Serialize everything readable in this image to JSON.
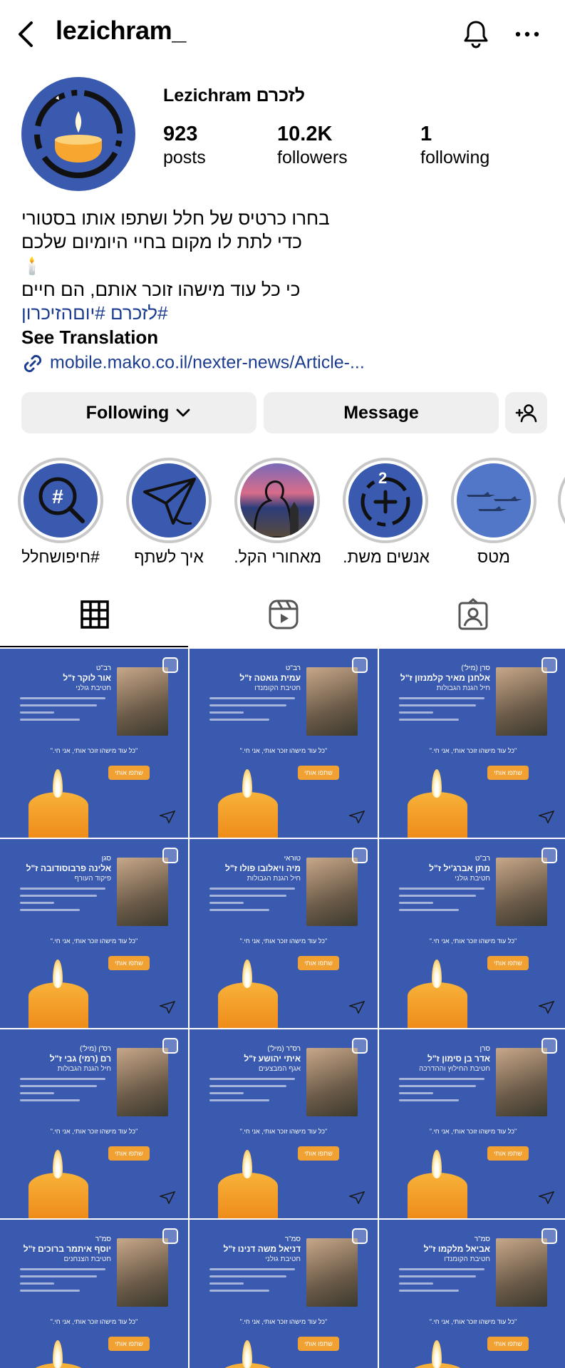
{
  "header": {
    "username": "lezichram_"
  },
  "profile": {
    "display_name": "Lezichram  לזכרם",
    "posts_count": "923",
    "posts_label": "posts",
    "followers_count": "10.2K",
    "followers_label": "followers",
    "following_count": "1",
    "following_label": "following"
  },
  "bio": {
    "line1": "בחרו כרטיס של חלל ושתפו אותו בסטורי",
    "line2": "כדי לתת לו מקום בחיי היומיום שלכם",
    "line3": "🕯️",
    "line4": "כי כל עוד מישהו זוכר אותם, הם חיים",
    "hashtags": "#לזכרם #יוםהזיכרון",
    "see_translation": "See Translation",
    "link": "mobile.mako.co.il/nexter-news/Article-..."
  },
  "actions": {
    "following": "Following",
    "message": "Message"
  },
  "highlights": [
    {
      "label": "#חיפושחלל",
      "icon": "hashtag-search-icon"
    },
    {
      "label": "איך לשתף",
      "icon": "paper-plane-icon"
    },
    {
      "label": "מאחורי הקל...",
      "icon": "silhouette-icon"
    },
    {
      "label": "אנשים משת...",
      "icon": "add-circle-icon"
    },
    {
      "label": "מטס",
      "icon": "jets-icon"
    }
  ],
  "tabs": [
    "grid-icon",
    "reels-icon",
    "tagged-icon"
  ],
  "posts": [
    {
      "rank": "רב\"ט",
      "name": "אור לוקר ז\"ל",
      "unit": "חטיבת גולני"
    },
    {
      "rank": "רב\"ט",
      "name": "עמית גואטה ז\"ל",
      "unit": "חטיבת הקומנדו"
    },
    {
      "rank": "סרן (מיל')",
      "name": "אלחנן מאיר קלמנזון ז\"ל",
      "unit": "חיל הגנת הגבולות"
    },
    {
      "rank": "סגן",
      "name": "אלינה פרבוסודובה ז\"ל",
      "unit": "פיקוד העורף"
    },
    {
      "rank": "טוראי",
      "name": "מיה ויאלובו פולו ז\"ל",
      "unit": "חיל הגנת הגבולות"
    },
    {
      "rank": "רב\"ט",
      "name": "מתן אברג'יל ז\"ל",
      "unit": "חטיבת גולני"
    },
    {
      "rank": "רס\"ן (מיל')",
      "name": "רם (רמי) גבי ז\"ל",
      "unit": "חיל הגנת הגבולות"
    },
    {
      "rank": "רס\"ר (מיל')",
      "name": "איתי יהושע ז\"ל",
      "unit": "אגף המבצעים"
    },
    {
      "rank": "סרן",
      "name": "אדר בן סימון ז\"ל",
      "unit": "חטיבת החילוץ וההדרכה"
    },
    {
      "rank": "סמ\"ר",
      "name": "יוסף איתמר ברוכים ז\"ל",
      "unit": "חטיבת הצנחנים"
    },
    {
      "rank": "סמ\"ר",
      "name": "דניאל משה דנינו ז\"ל",
      "unit": "חטיבת גולני"
    },
    {
      "rank": "סמ\"ר",
      "name": "אביאל מלקמו ז\"ל",
      "unit": "חטיבת הקומנדו"
    }
  ],
  "post_common": {
    "quote": "\"כל עוד מישהו זוכר אותי, אני חי.\"",
    "share": "שתפו אותי"
  }
}
